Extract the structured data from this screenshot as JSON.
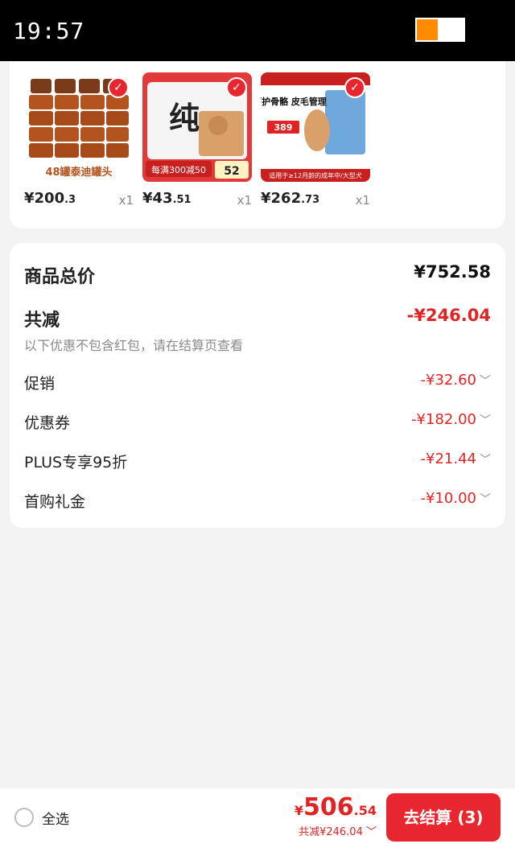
{
  "status_bar": {
    "time": "19:57",
    "battery_level": 0.45,
    "battery_color": "#ff8c00"
  },
  "products": [
    {
      "image_caption": "48罐泰迪罐头",
      "price_main": "¥200",
      "price_decimal": ".3",
      "qty": "x1",
      "selected": true
    },
    {
      "image_caption": "纯",
      "image_badge": "每满300减50",
      "image_price": "52",
      "price_main": "¥43",
      "price_decimal": ".51",
      "qty": "x1",
      "selected": true
    },
    {
      "image_caption": "呵护骨骼 皮毛管理",
      "image_price": "389",
      "image_footer": "适用于≥12月龄的成年中/大型犬",
      "price_main": "¥262",
      "price_decimal": ".73",
      "qty": "x1",
      "selected": true
    }
  ],
  "summary": {
    "total_label": "商品总价",
    "total_value": "¥752.58",
    "discount_label": "共减",
    "discount_value": "-¥246.04",
    "discount_note": "以下优惠不包含红包，请在结算页查看",
    "lines": [
      {
        "label": "促销",
        "value": "-¥32.60"
      },
      {
        "label": "优惠券",
        "value": "-¥182.00"
      },
      {
        "label": "PLUS专享95折",
        "value": "-¥21.44"
      },
      {
        "label": "首购礼金",
        "value": "-¥10.00"
      }
    ]
  },
  "footer": {
    "select_all": "全选",
    "final_yen": "¥",
    "final_int": "506",
    "final_dec": ".54",
    "final_discount": "共减¥246.04",
    "checkout": "去结算 (3)"
  },
  "colors": {
    "accent": "#e8262f",
    "price_red": "#e02424"
  },
  "icons": {
    "check": "check-icon",
    "chevron": "chevron-down-icon",
    "battery": "battery-icon"
  }
}
